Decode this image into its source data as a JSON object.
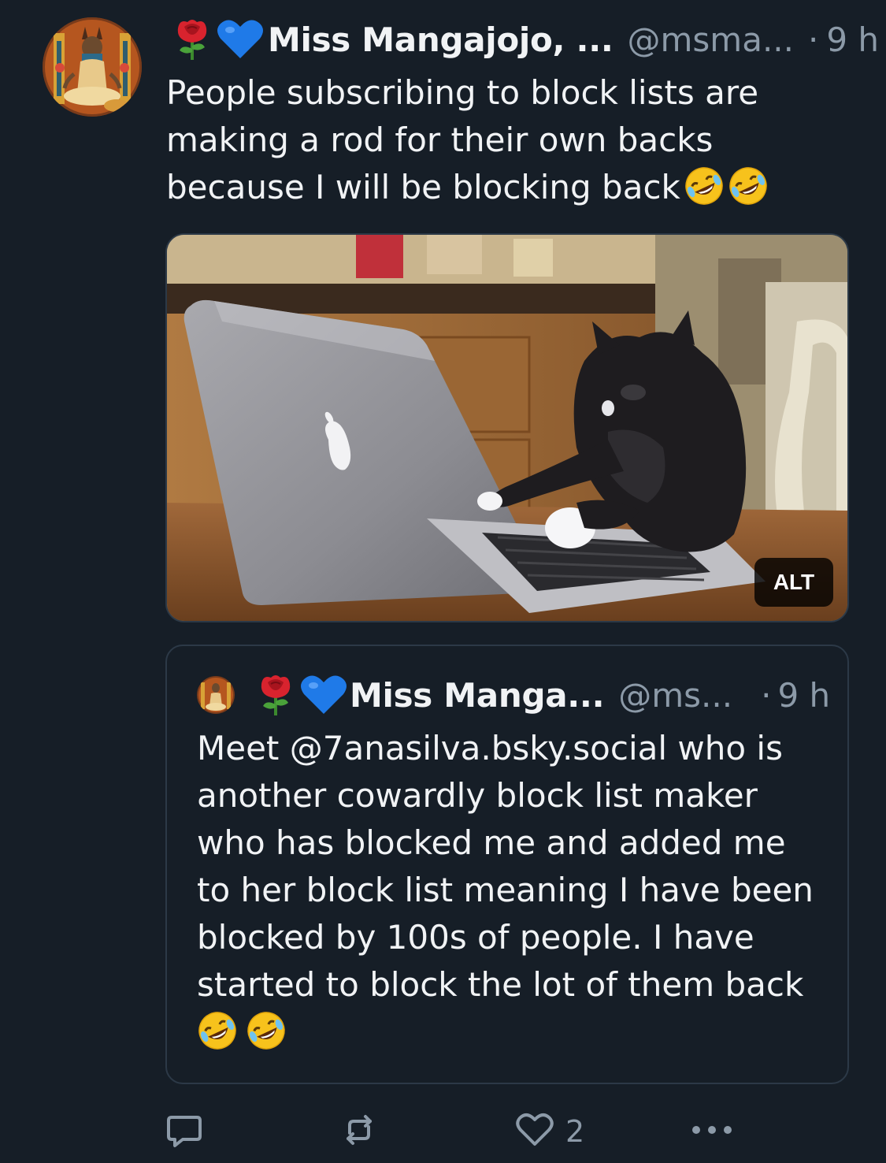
{
  "post": {
    "display_name": "Miss Mangajojo, ...",
    "handle": "@msma...",
    "dot": "·",
    "time": "9 h",
    "text": "People subscribing to block lists are making a rod for their own backs because I will be blocking back",
    "name_emojis": [
      "rose-emoji",
      "blue-heart-emoji"
    ],
    "text_emojis": [
      "rolling-on-floor-laughing-emoji",
      "rolling-on-floor-laughing-emoji"
    ]
  },
  "media": {
    "alt_badge": "ALT",
    "description_icon": "cat-typing-on-laptop-image"
  },
  "quote": {
    "display_name": "Miss Manga...",
    "handle": "@ms...",
    "dot": "·",
    "time": "9 h",
    "text": "Meet @7anasilva.bsky.social who is another cowardly block list maker who has blocked me and added me to her block list meaning I have been blocked by 100s of people. I have started to block the lot of them back"
  },
  "actions": {
    "reply_icon": "reply-icon",
    "repost_icon": "repost-icon",
    "like_icon": "heart-icon",
    "like_count": "2",
    "more_icon": "more-icon"
  },
  "colors": {
    "background": "#161e27",
    "text": "#f1f3f5",
    "muted": "#8c9aa8",
    "border": "#2c3947"
  }
}
